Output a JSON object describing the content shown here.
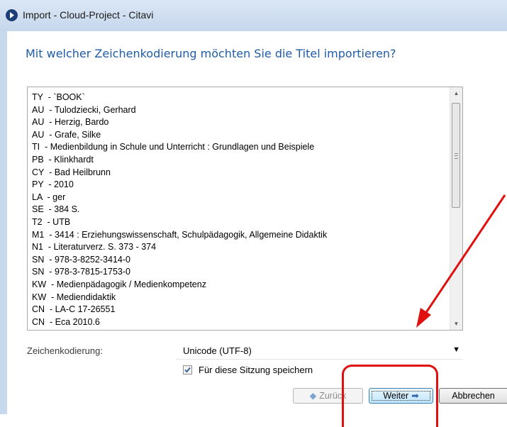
{
  "window": {
    "title": "Import - Cloud-Project - Citavi"
  },
  "heading": "Mit welcher Zeichenkodierung möchten Sie die Titel importieren?",
  "preview_lines": [
    "TY  - `BOOK`",
    "AU  - Tulodziecki, Gerhard",
    "AU  - Herzig, Bardo",
    "AU  - Grafe, Silke",
    "TI  - Medienbildung in Schule und Unterricht : Grundlagen und Beispiele",
    "PB  - Klinkhardt",
    "CY  - Bad Heilbrunn",
    "PY  - 2010",
    "LA  - ger",
    "SE  - 384 S.",
    "T2  - UTB",
    "M1  - 3414 : Erziehungswissenschaft, Schulpädagogik, Allgemeine Didaktik",
    "N1  - Literaturverz. S. 373 - 374",
    "SN  - 978-3-8252-3414-0",
    "SN  - 978-3-7815-1753-0",
    "KW  - Medienpädagogik / Medienkompetenz",
    "KW  - Mediendidaktik",
    "CN  - LA-C 17-26551",
    "CN  - Eca 2010.6"
  ],
  "encoding": {
    "label": "Zeichenkodierung:",
    "selected": "Unicode (UTF-8)"
  },
  "save_session": {
    "label": "Für diese Sitzung speichern",
    "checked": true
  },
  "buttons": {
    "back": "Zurück",
    "next": "Weiter",
    "cancel": "Abbrechen"
  },
  "icons": {
    "app": "citavi-app-icon",
    "scroll_up": "scroll-up-arrow-icon",
    "scroll_down": "scroll-down-arrow-icon",
    "dropdown": "chevron-down-icon",
    "back": "arrow-left-icon",
    "next": "arrow-right-icon",
    "check": "checkmark-icon"
  },
  "colors": {
    "heading": "#1f5ca8",
    "annotation": "#e11010",
    "titlebar": "#c9d9ec"
  }
}
